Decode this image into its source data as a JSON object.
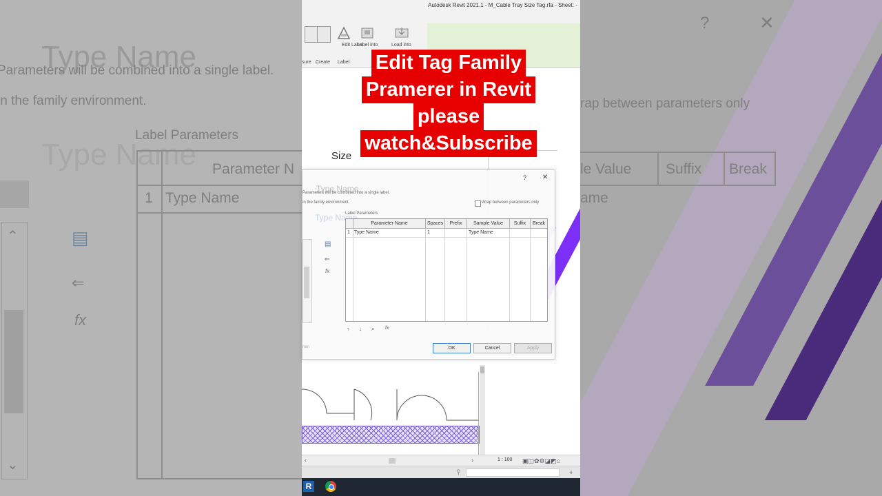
{
  "window": {
    "title": "Autodesk Revit 2021.1 - M_Cable Tray Size Tag.rfa - Sheet: -"
  },
  "ribbon": {
    "labels": [
      "sure",
      "Create",
      "Label"
    ],
    "edit_label": "Edit Label",
    "label_into": "Label into",
    "load_into": "Load into"
  },
  "banner": {
    "lines": [
      "Edit Tag Family",
      "Pramerer in Revit",
      "please",
      "watch&Subscribe"
    ]
  },
  "canvas": {
    "size_label": "Size",
    "scale": "1 : 100"
  },
  "dialog": {
    "help": "?",
    "close": "✕",
    "title_ghost": "Type Name",
    "info_line1": "Parameters will be combined into a single label.",
    "info_line2": "in the family environment.",
    "wrap_checkbox": "Wrap between parameters only",
    "group_label": "Label Parameters",
    "columns": [
      "Parameter Name",
      "Spaces",
      "Prefix",
      "Sample Value",
      "Suffix",
      "Break"
    ],
    "rows": [
      {
        "index": "1",
        "parameter_name": "Type Name",
        "spaces": "1",
        "prefix": "",
        "sample_value": "Type Name",
        "suffix": "",
        "break": ""
      }
    ],
    "units_hint": "mm",
    "ok": "OK",
    "cancel": "Cancel",
    "apply": "Apply"
  },
  "background": {
    "type_name_big": "Type Name",
    "info_line1": "Parameters will be combined into a single label.",
    "info_line2": "in the family environment.",
    "label_parameters": "Label Parameters",
    "parameter_header": "Parameter N",
    "row_index": "1",
    "row_value": "Type Name",
    "wrap_text": "rap between parameters only",
    "sample_value": "le Value",
    "suffix": "Suffix",
    "break": "Break",
    "row_sample": "ame"
  },
  "colors": {
    "banner_red": "#e60000",
    "accent_purple": "#7b2ff7",
    "ribbon_green": "#e3f2d6"
  }
}
